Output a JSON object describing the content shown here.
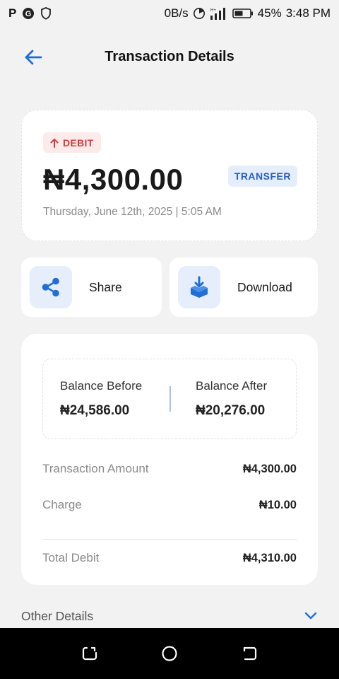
{
  "status_bar": {
    "left_icons": [
      "p-icon",
      "g-icon",
      "shield-icon"
    ],
    "p_glyph": "P",
    "g_glyph": "G",
    "speed": "0B/s",
    "battery": "45%",
    "time": "3:48 PM"
  },
  "header": {
    "title": "Transaction Details"
  },
  "summary": {
    "direction_label": "DEBIT",
    "amount": "₦4,300.00",
    "type_label": "TRANSFER",
    "date": "Thursday, June 12th, 2025 | 5:05 AM"
  },
  "actions": {
    "share_label": "Share",
    "download_label": "Download"
  },
  "balances": {
    "before_label": "Balance Before",
    "before_value": "₦24,586.00",
    "after_label": "Balance After",
    "after_value": "₦20,276.00"
  },
  "details": {
    "rows": [
      {
        "label": "Transaction Amount",
        "value": "₦4,300.00"
      },
      {
        "label": "Charge",
        "value": "₦10.00"
      },
      {
        "label": "Total Debit",
        "value": "₦4,310.00"
      }
    ]
  },
  "other": {
    "label": "Other Details"
  },
  "colors": {
    "accent_blue": "#1f6fd6",
    "debit_red": "#d43c3c",
    "badge_red_bg": "#fdeaea",
    "badge_blue_bg": "#e4eefc",
    "background": "#f2f2f2"
  }
}
